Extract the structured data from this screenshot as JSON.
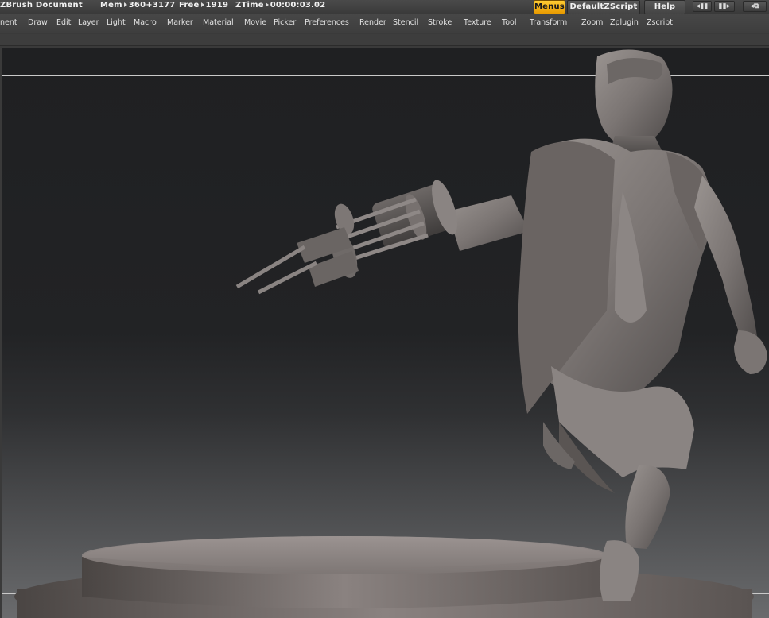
{
  "titlebar": {
    "doc_title": "ZBrush Document",
    "mem_label": "Mem",
    "mem_value": "360+3177",
    "free_label": "Free",
    "free_value": "1919",
    "ztime_label": "ZTime",
    "ztime_value": "00:00:03.02",
    "menus_button": "Menus",
    "script_button": "DefaultZScript",
    "help_button": "Help"
  },
  "menu": {
    "items": [
      "nent",
      "Draw",
      "Edit",
      "Layer",
      "Light",
      "Macro",
      "Marker",
      "Material",
      "Movie",
      "Picker",
      "Preferences",
      "Render",
      "Stencil",
      "Stroke",
      "Texture",
      "Tool",
      "Transform",
      "Zoom",
      "Zplugin",
      "Zscript"
    ]
  },
  "colors": {
    "accent": "#f5b100",
    "canvas_top": "#1f2022",
    "canvas_bottom": "#6a6b6d",
    "clay": "#7d7876"
  },
  "icons": {
    "arrow": "play-arrow-icon",
    "controls": [
      "scroll-left-icon",
      "scroll-right-icon",
      "window-layout-icon"
    ]
  }
}
